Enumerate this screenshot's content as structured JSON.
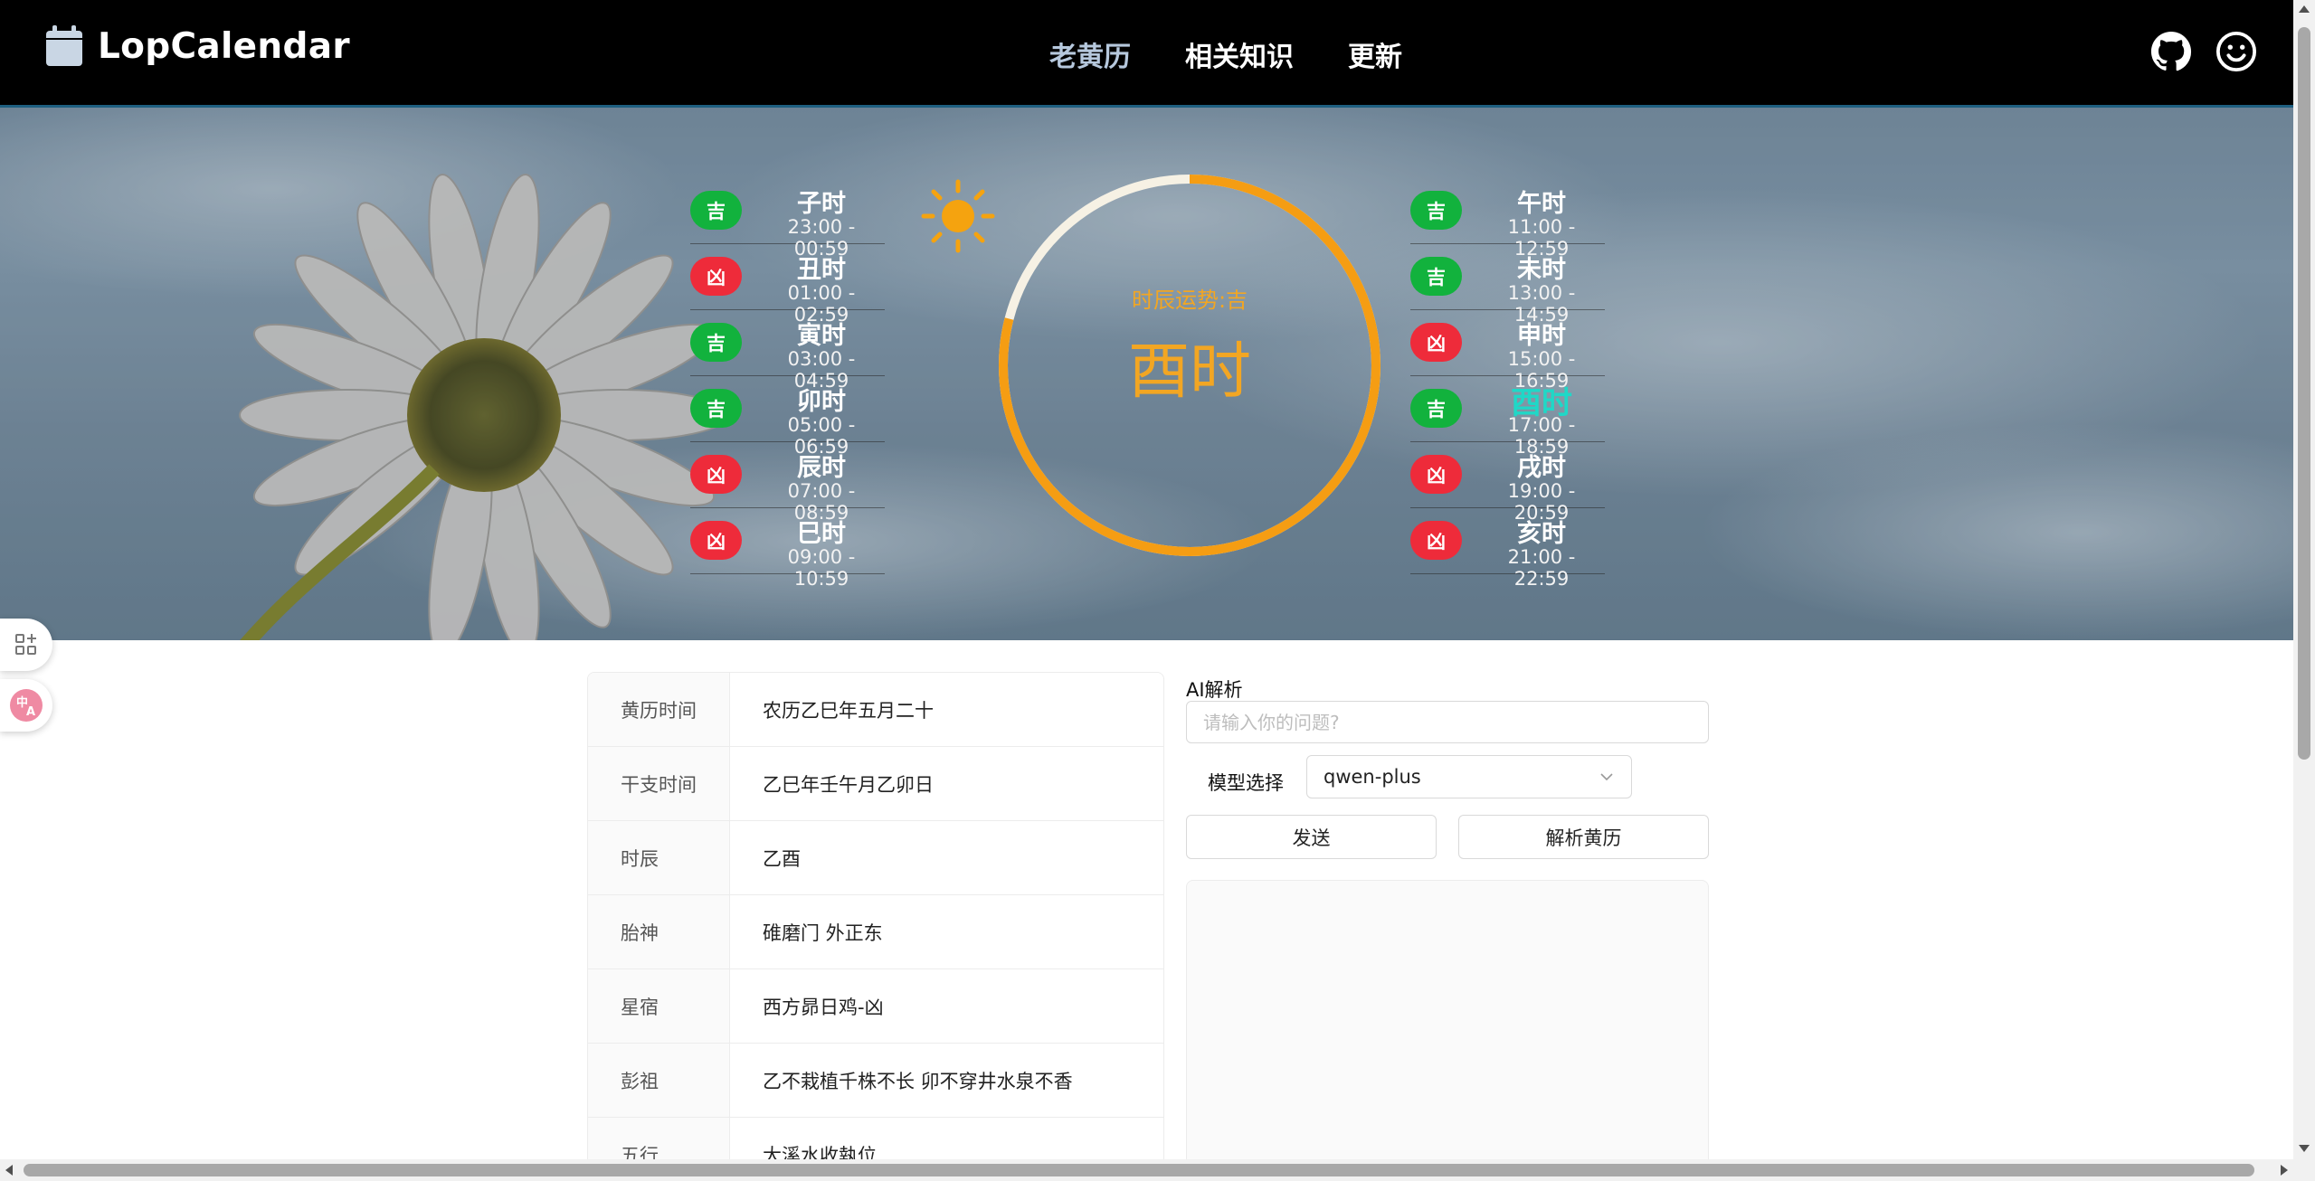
{
  "app": {
    "name": "LopCalendar"
  },
  "nav": {
    "items": [
      "老黄历",
      "相关知识",
      "更新"
    ],
    "active": 0
  },
  "hero": {
    "left_hours": [
      {
        "badge": "吉",
        "fortune": "good",
        "name": "子时",
        "time": "23:00 - 00:59"
      },
      {
        "badge": "凶",
        "fortune": "bad",
        "name": "丑时",
        "time": "01:00 - 02:59"
      },
      {
        "badge": "吉",
        "fortune": "good",
        "name": "寅时",
        "time": "03:00 - 04:59"
      },
      {
        "badge": "吉",
        "fortune": "good",
        "name": "卯时",
        "time": "05:00 - 06:59"
      },
      {
        "badge": "凶",
        "fortune": "bad",
        "name": "辰时",
        "time": "07:00 - 08:59"
      },
      {
        "badge": "凶",
        "fortune": "bad",
        "name": "巳时",
        "time": "09:00 - 10:59"
      }
    ],
    "right_hours": [
      {
        "badge": "吉",
        "fortune": "good",
        "name": "午时",
        "time": "11:00 - 12:59"
      },
      {
        "badge": "吉",
        "fortune": "good",
        "name": "未时",
        "time": "13:00 - 14:59"
      },
      {
        "badge": "凶",
        "fortune": "bad",
        "name": "申时",
        "time": "15:00 - 16:59"
      },
      {
        "badge": "吉",
        "fortune": "good",
        "name": "酉时",
        "time": "17:00 - 18:59",
        "current": true
      },
      {
        "badge": "凶",
        "fortune": "bad",
        "name": "戌时",
        "time": "19:00 - 20:59"
      },
      {
        "badge": "凶",
        "fortune": "bad",
        "name": "亥时",
        "time": "21:00 - 22:59"
      }
    ],
    "clock": {
      "label": "时辰运势:吉",
      "hour": "酉时",
      "progress": 0.79
    },
    "colors": {
      "good": "#12b23d",
      "bad": "#ee2b3a",
      "accent": "#f2a623",
      "current": "#1fd8c7"
    }
  },
  "info": {
    "rows": [
      {
        "label": "黄历时间",
        "value": "农历乙巳年五月二十"
      },
      {
        "label": "干支时间",
        "value": "乙巳年壬午月乙卯日"
      },
      {
        "label": "时辰",
        "value": "乙酉"
      },
      {
        "label": "胎神",
        "value": "碓磨门 外正东"
      },
      {
        "label": "星宿",
        "value": "西方昴日鸡-凶"
      },
      {
        "label": "彭祖",
        "value": "乙不栽植千株不长 卯不穿井水泉不香"
      },
      {
        "label": "五行",
        "value": "大溪水收執位"
      }
    ]
  },
  "ai": {
    "title": "AI解析",
    "input_value": "",
    "input_placeholder": "请输入你的问题?",
    "model_label": "模型选择",
    "model_value": "qwen-plus",
    "send_label": "发送",
    "parse_label": "解析黄历",
    "output": ""
  }
}
